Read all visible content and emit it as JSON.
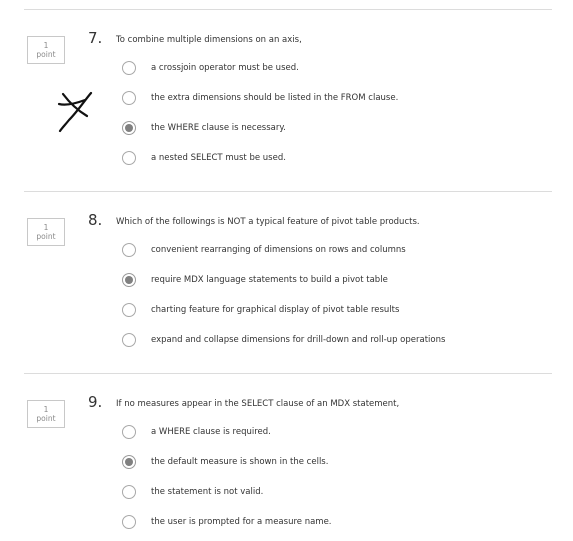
{
  "questions": [
    {
      "number": "7.",
      "points_value": "1",
      "points_label": "point",
      "prompt": "To combine multiple dimensions on an axis,",
      "options": [
        {
          "label": "a crossjoin operator must be used.",
          "selected": false
        },
        {
          "label": "the extra dimensions should be listed in the FROM clause.",
          "selected": false
        },
        {
          "label": "the WHERE clause is necessary.",
          "selected": true
        },
        {
          "label": "a nested SELECT must be used.",
          "selected": false
        }
      ]
    },
    {
      "number": "8.",
      "points_value": "1",
      "points_label": "point",
      "prompt": "Which of the followings is NOT a typical feature of pivot table products.",
      "options": [
        {
          "label": "convenient rearranging of dimensions on rows and columns",
          "selected": false
        },
        {
          "label": "require MDX language statements to build a pivot table",
          "selected": true
        },
        {
          "label": "charting feature for graphical display of pivot table results",
          "selected": false
        },
        {
          "label": "expand and collapse dimensions for drill-down and roll-up operations",
          "selected": false
        }
      ]
    },
    {
      "number": "9.",
      "points_value": "1",
      "points_label": "point",
      "prompt": "If no measures appear in the SELECT clause of an MDX statement,",
      "options": [
        {
          "label": "a WHERE clause is required.",
          "selected": false
        },
        {
          "label": "the default measure is shown in the cells.",
          "selected": true
        },
        {
          "label": "the statement is not valid.",
          "selected": false
        },
        {
          "label": "the user is prompted for a measure name.",
          "selected": false
        }
      ]
    }
  ],
  "colors": {
    "divider": "#dcdcdc",
    "radio_border": "#a8a8a8",
    "radio_selected_dot": "#808080",
    "text": "#333333",
    "points_text": "#8a8a8a",
    "handwritten_mark": "#111111"
  },
  "icons": {
    "handwritten_mark": "handwritten-x-mark-icon"
  }
}
